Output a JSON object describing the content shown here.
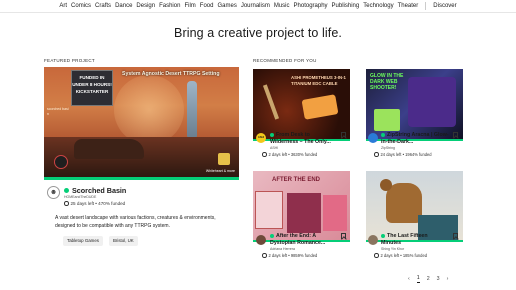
{
  "nav": {
    "categories": [
      "Art",
      "Comics",
      "Crafts",
      "Dance",
      "Design",
      "Fashion",
      "Film",
      "Food",
      "Games",
      "Journalism",
      "Music",
      "Photography",
      "Publishing",
      "Technology",
      "Theater"
    ],
    "discover": "Discover"
  },
  "headline": "Bring a creative project to life.",
  "featured": {
    "section_label": "FEATURED PROJECT",
    "image": {
      "title": "System Agnostic Desert TTRPG Setting",
      "badge": "FUNDED IN UNDER 8 HOURS! KICKSTARTER",
      "side_text": "scorched basin",
      "corner_text": "Whiteheart & more"
    },
    "progress_fraction": 1.0,
    "title": "Scorched Basin",
    "creator": "HOMEandTheDUDE",
    "meta": "25 days left • 470% funded",
    "description": "A vast desert landscape with various factions, creatures & environments, designed to be compatible with any TTRPG system.",
    "tags": [
      "Tabletop Games",
      "Bristol, UK"
    ]
  },
  "recommended": {
    "section_label": "RECOMMENDED FOR YOU",
    "cards": [
      {
        "title": "From Desk to Wilderness – The Only...",
        "creator": "ASHI",
        "meta": "2 days left • 3630% funded",
        "image_text": "ASHI PROMETHEUS 3-IN-1 TITANIUM EDC CABLE",
        "avatar_text": "ASHI"
      },
      {
        "title": "ZipString Aracna | Glow-in-the-Dark...",
        "creator": "ZipString",
        "meta": "24 days left • 1964% funded",
        "image_text": "GLOW IN THE DARK WEB SHOOTER!",
        "avatar_text": ""
      },
      {
        "title": "After the End: A Dystopian Romance...",
        "creator": "Adriana Herrera",
        "meta": "2 days left • 9859% funded",
        "image_text": "AFTER THE END",
        "avatar_text": ""
      },
      {
        "title": "The Last Fifteen Minutes",
        "creator": "Shing Yin Khor",
        "meta": "2 days left • 185% funded",
        "image_text": "",
        "avatar_text": ""
      }
    ]
  },
  "pagination": {
    "prev": "‹",
    "pages": [
      "1",
      "2",
      "3"
    ],
    "current": "1",
    "next": "›"
  },
  "colors": {
    "accent_green": "#05ce78",
    "text": "#1a1a1a"
  }
}
